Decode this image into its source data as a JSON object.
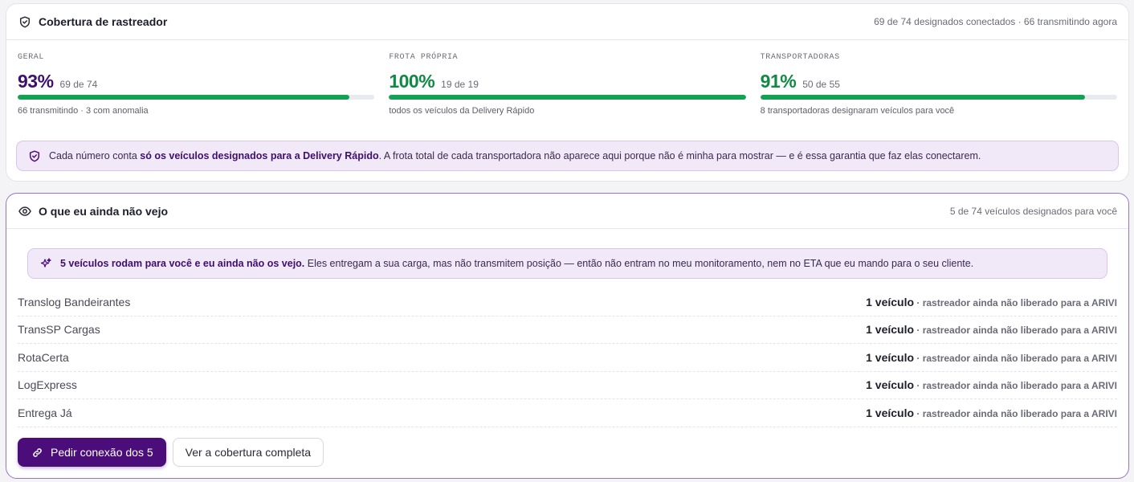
{
  "coverage": {
    "title": "Cobertura de rastreador",
    "summary": "69 de 74 designados conectados · 66 transmitindo agora",
    "metrics": [
      {
        "label": "GERAL",
        "value": "93%",
        "sub": "69 de 74",
        "progress": 0.93,
        "foot": "66 transmitindo · 3 com anomalia",
        "color": "#3f0f6e"
      },
      {
        "label": "FROTA PRÓPRIA",
        "value": "100%",
        "sub": "19 de 19",
        "progress": 1.0,
        "foot": "todos os veículos da Delivery Rápido",
        "color": "#0e8a43"
      },
      {
        "label": "TRANSPORTADORAS",
        "value": "91%",
        "sub": "50 de 55",
        "progress": 0.91,
        "foot": "8 transportadoras designaram veículos para você",
        "color": "#0e8a43"
      }
    ],
    "note": {
      "prefix": "Cada número conta ",
      "bold": "só os veículos designados para a Delivery Rápido",
      "suffix": ". A frota total de cada transportadora não aparece aqui porque não é minha para mostrar — e é essa garantia que faz elas conectarem."
    }
  },
  "unseen": {
    "title": "O que eu ainda não vejo",
    "summary": "5 de 74 veículos designados para você",
    "banner": {
      "bold": "5 veículos rodam para você e eu ainda não os vejo.",
      "rest": " Eles entregam a sua carga, mas não transmitem posição — então não entram no meu monitoramento, nem no ETA que eu mando para o seu cliente."
    },
    "rows": [
      {
        "name": "Translog Bandeirantes",
        "count": "1 veículo",
        "status": " · rastreador ainda não liberado para a ARIVI"
      },
      {
        "name": "TransSP Cargas",
        "count": "1 veículo",
        "status": " · rastreador ainda não liberado para a ARIVI"
      },
      {
        "name": "RotaCerta",
        "count": "1 veículo",
        "status": " · rastreador ainda não liberado para a ARIVI"
      },
      {
        "name": "LogExpress",
        "count": "1 veículo",
        "status": " · rastreador ainda não liberado para a ARIVI"
      },
      {
        "name": "Entrega Já",
        "count": "1 veículo",
        "status": " · rastreador ainda não liberado para a ARIVI"
      }
    ],
    "primary_button": "Pedir conexão dos 5",
    "secondary_button": "Ver a cobertura completa"
  },
  "icons": {
    "shield": "shield-check-icon",
    "eye": "eye-icon",
    "sparkle": "sparkle-icon",
    "link": "link-icon"
  },
  "colors": {
    "accent": "#4b0d7a",
    "progress": "#13a254",
    "note_bg": "#f1e8f8"
  }
}
